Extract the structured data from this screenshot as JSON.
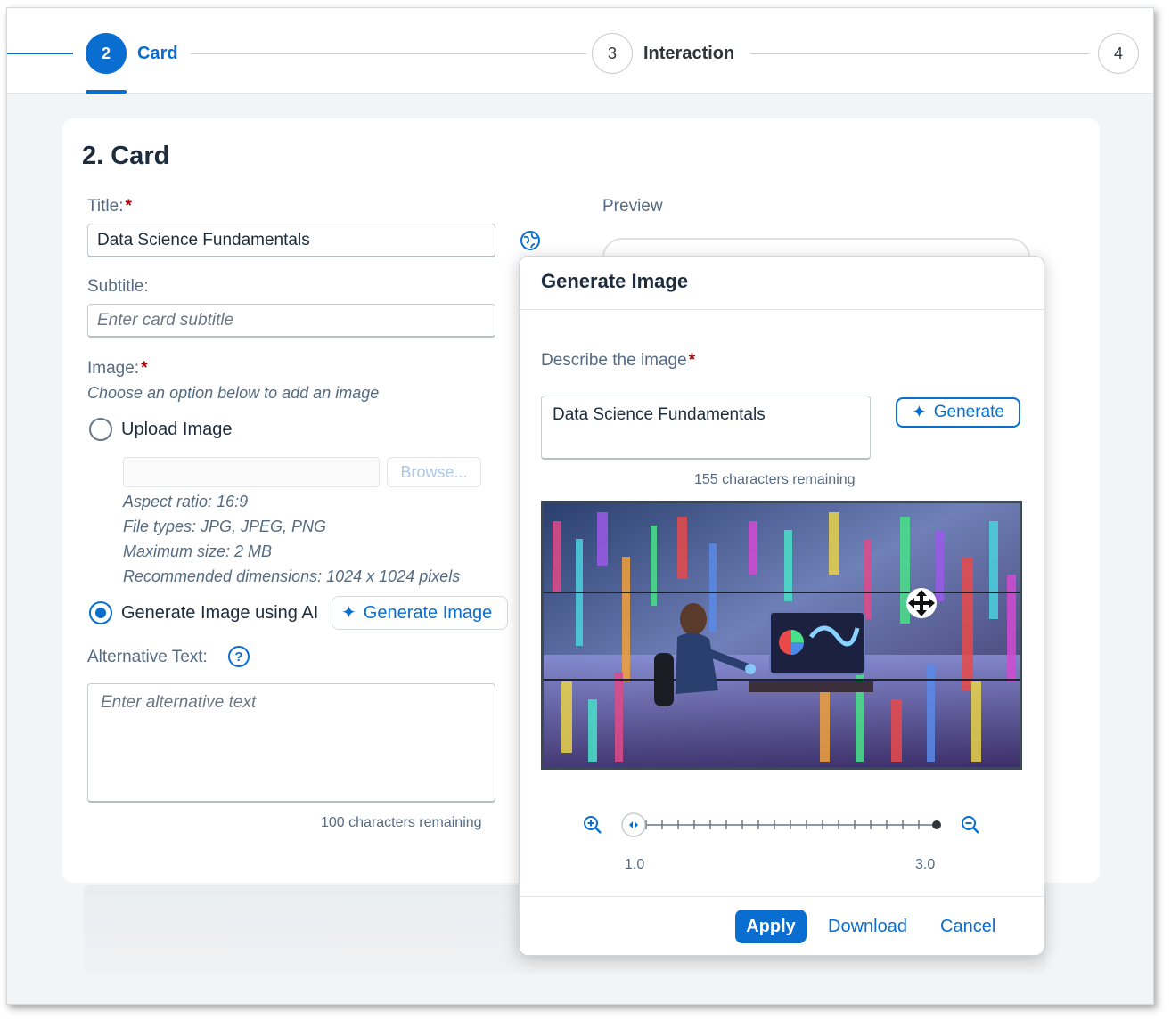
{
  "wizard": {
    "steps": [
      {
        "number": "2",
        "label": "Card",
        "active": true
      },
      {
        "number": "3",
        "label": "Interaction",
        "active": false
      },
      {
        "number": "4",
        "label": "",
        "active": false
      }
    ]
  },
  "form": {
    "section_title": "2. Card",
    "title_label": "Title:",
    "required_mark": "*",
    "title_value": "Data Science Fundamentals",
    "subtitle_label": "Subtitle:",
    "subtitle_placeholder": "Enter card subtitle",
    "image_label": "Image:",
    "image_hint": "Choose an option below to add an image",
    "upload_option": "Upload Image",
    "browse_label": "Browse...",
    "upload_hints": [
      "Aspect ratio: 16:9",
      "File types: JPG, JPEG, PNG",
      "Maximum size: 2 MB",
      "Recommended dimensions: 1024 x 1024 pixels"
    ],
    "generate_option": "Generate Image using AI",
    "generate_image_button": "Generate Image",
    "alt_text_label": "Alternative Text:",
    "alt_text_placeholder": "Enter alternative text",
    "alt_text_counter": "100 characters remaining",
    "selected_image_option": "generate"
  },
  "preview": {
    "label": "Preview"
  },
  "dialog": {
    "title": "Generate Image",
    "describe_label": "Describe the image",
    "describe_value": "Data Science Fundamentals",
    "generate_button": "Generate",
    "counter": "155 characters remaining",
    "zoom": {
      "min_label": "1.0",
      "max_label": "3.0",
      "value": 1.0
    },
    "apply_button": "Apply",
    "download_button": "Download",
    "cancel_button": "Cancel"
  },
  "colors": {
    "accent": "#0a6ed1",
    "required": "#aa0808"
  }
}
